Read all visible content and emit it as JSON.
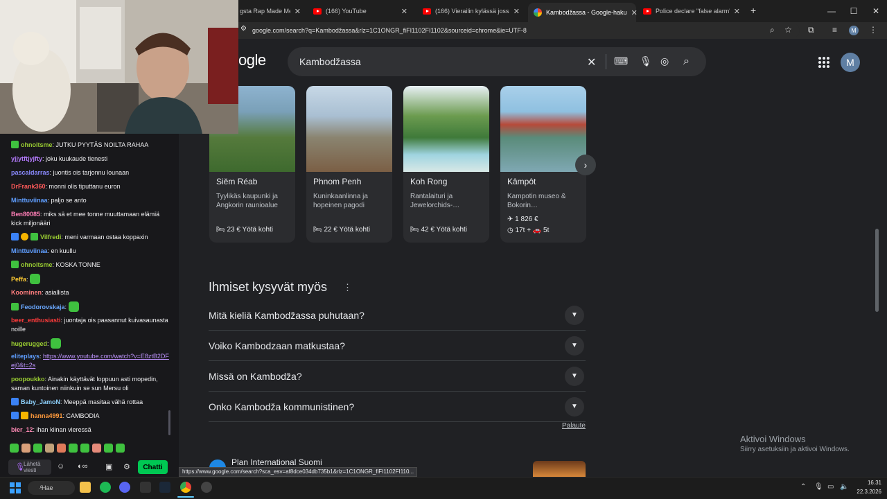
{
  "browser": {
    "tabs": [
      {
        "label": "gsta Rap Made Me D",
        "icon": "youtube"
      },
      {
        "label": "(166) YouTube",
        "icon": "youtube"
      },
      {
        "label": "(166) Vierailin kylässä jossa syö",
        "icon": "youtube"
      },
      {
        "label": "Kambodžassa - Google-haku",
        "icon": "google",
        "active": true
      },
      {
        "label": "Police declare \"false alarm\" as a",
        "icon": "youtube"
      }
    ],
    "url": "google.com/search?q=Kambodžassa&rlz=1C1ONGR_fiFI1102FI1102&sourceid=chrome&ie=UTF-8",
    "avatar_letter": "M"
  },
  "google": {
    "logo": "ogle",
    "query": "Kambodžassa",
    "avatar_letter": "M",
    "destinations": [
      {
        "name": "Siĕm Réab",
        "desc": "Tyylikäs kaupunki ja Angkorin raunioalue",
        "price": "23 € Yötä kohti",
        "colors": [
          "#6f8fa6",
          "#557a3c"
        ]
      },
      {
        "name": "Phnom Penh",
        "desc": "Kuninkaanlinna ja hopeinen pagodi",
        "price": "22 € Yötä kohti",
        "colors": [
          "#9db4c8",
          "#7d7560"
        ]
      },
      {
        "name": "Koh Rong",
        "desc": "Rantalaituri ja Jewelorchids-…",
        "price": "42 € Yötä kohti",
        "colors": [
          "#8fc2e0",
          "#3f7a3a"
        ]
      },
      {
        "name": "Kâmpôt",
        "desc": "Kampotin museo & Bokorin…",
        "flight": "1 826 €",
        "travel": "17t + 🚗 5t",
        "colors": [
          "#9ec7e3",
          "#5a8b7a"
        ]
      }
    ],
    "paa_title": "Ihmiset kysyvät myös",
    "questions": [
      "Mitä kieliä Kambodžassa puhutaan?",
      "Voiko Kambodzaan matkustaa?",
      "Missä on Kambodža?",
      "Onko Kambodža kommunistinen?"
    ],
    "feedback": "Palaute",
    "next_result": "Plan International Suomi",
    "status_url": "https://www.google.com/search?sca_esv=af8dce034db735b1&rlz=1C1ONGR_fiFI1102FI110..."
  },
  "windows_activation": {
    "line1": "Aktivoi Windows",
    "line2": "Siirry asetuksiin ja aktivoi Windows."
  },
  "chat": {
    "messages": [
      {
        "user": "ohnoitsme",
        "color": "#9acd32",
        "text": "JUTKU PYYTÄS NOILTA RAHAA"
      },
      {
        "user": "yjjytftjyjfty",
        "color": "#b57bff",
        "text": "joku kuukaude tienesti"
      },
      {
        "user": "pascaldarras",
        "color": "#8a8aff",
        "text": "juontis ois tarjonnu lounaan"
      },
      {
        "user": "DrFrank360",
        "color": "#ff5a5a",
        "text": "monni olis tiputtanu euron"
      },
      {
        "user": "Minttuviinaa",
        "color": "#5f9eff",
        "text": "paljo se anto"
      },
      {
        "user": "Ben80085",
        "color": "#ff7eb6",
        "text": "miks sä et mee tonne muuttamaan elämiä kick miljonääri"
      },
      {
        "user": "Vilfredi",
        "color": "#9acd32",
        "text": "meni varmaan ostaa koppaxin"
      },
      {
        "user": "Minttuviinaa",
        "color": "#5f9eff",
        "text": "en kuullu"
      },
      {
        "user": "ohnoitsme",
        "color": "#9acd32",
        "text": "KOSKA TONNE"
      },
      {
        "user": "Peffa",
        "color": "#ffcc33",
        "text": ""
      },
      {
        "user": "Koominen",
        "color": "#ff7e7e",
        "text": "asiallista"
      },
      {
        "user": "Feodorovskaja",
        "color": "#6aa8ff",
        "text": ""
      },
      {
        "user": "beer_enthusiasti",
        "color": "#ff3b3b",
        "text": "juontaja ois paasannut kuivasaunasta noille"
      },
      {
        "user": "hugerugged",
        "color": "#9acd32",
        "text": ""
      },
      {
        "user": "eliteplays",
        "color": "#5f9eff",
        "text": "https://www.youtube.com/watch?v=E8ztB2DFej0&t=2s"
      },
      {
        "user": "poopoukko",
        "color": "#9acd32",
        "text": "Ainakin käyttävät loppuun asti mopedin, saman kuntoinen niinkuin se sun Mersu oli"
      },
      {
        "user": "Baby_JamoN",
        "color": "#8fd3ff",
        "text": "Meeppä masitaa vähä rottaa"
      },
      {
        "user": "hanna4991",
        "color": "#ff9a3c",
        "text": "CAMBODIA"
      },
      {
        "user": "bier_12",
        "color": "#ff8ab5",
        "text": "ihan kiinan vieressä"
      }
    ],
    "input_placeholder": "Lähetä viesti",
    "send_label": "Chatti"
  },
  "taskbar": {
    "search_label": "Hae",
    "time": "16.31",
    "date": "22.3.2026"
  }
}
